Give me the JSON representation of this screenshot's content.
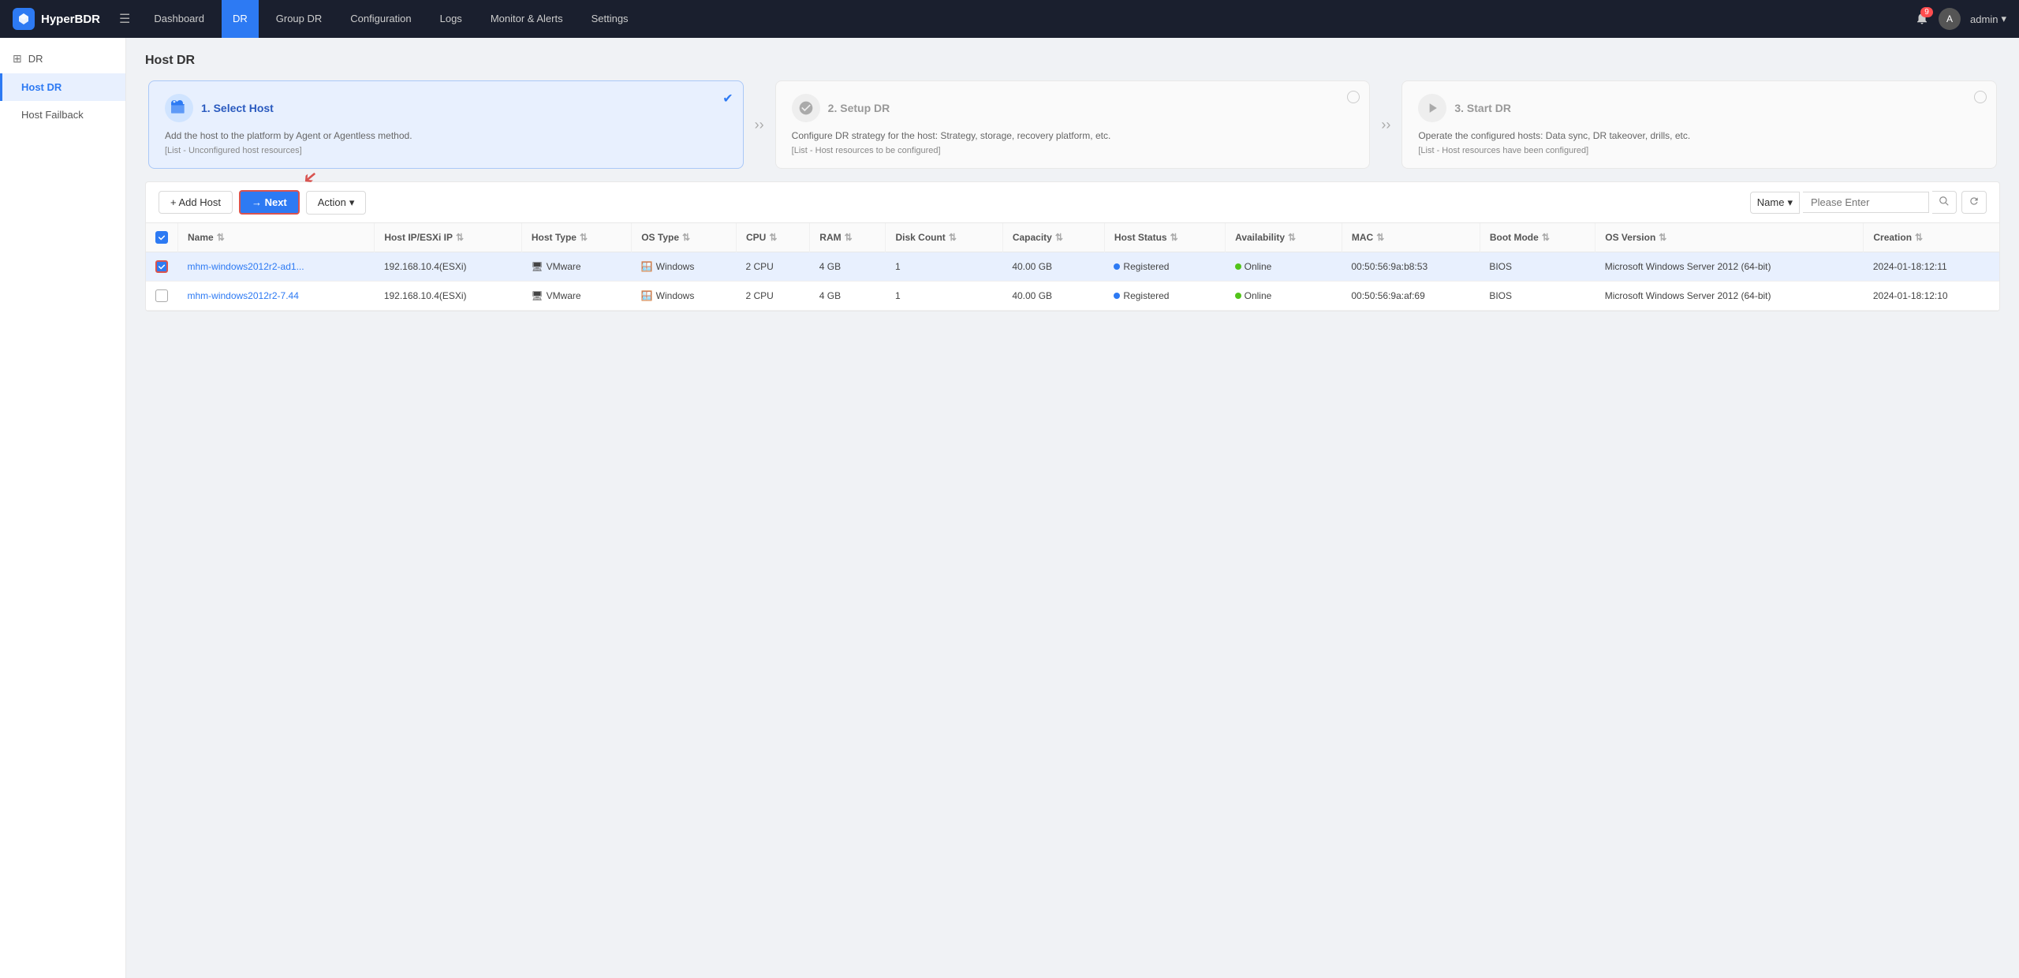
{
  "app": {
    "name": "HyperBDR",
    "logo_text": "HyperBDR"
  },
  "topnav": {
    "items": [
      {
        "label": "Dashboard",
        "active": false
      },
      {
        "label": "DR",
        "active": true
      },
      {
        "label": "Group DR",
        "active": false
      },
      {
        "label": "Configuration",
        "active": false
      },
      {
        "label": "Logs",
        "active": false
      },
      {
        "label": "Monitor & Alerts",
        "active": false
      },
      {
        "label": "Settings",
        "active": false
      }
    ],
    "notification_count": "9",
    "admin_label": "admin"
  },
  "sidebar": {
    "section_label": "DR",
    "items": [
      {
        "label": "Host DR",
        "active": true
      },
      {
        "label": "Host Failback",
        "active": false
      }
    ]
  },
  "breadcrumb": "Host DR",
  "steps": [
    {
      "number": "1.",
      "title": "Select Host",
      "desc": "Add the host to the platform by Agent or Agentless method.",
      "sub": "[List - Unconfigured host resources]",
      "active": true,
      "checked": true
    },
    {
      "number": "2.",
      "title": "Setup DR",
      "desc": "Configure DR strategy for the host: Strategy, storage, recovery platform, etc.",
      "sub": "[List - Host resources to be configured]",
      "active": false,
      "checked": false
    },
    {
      "number": "3.",
      "title": "Start DR",
      "desc": "Operate the configured hosts: Data sync, DR takeover, drills, etc.",
      "sub": "[List - Host resources have been configured]",
      "active": false,
      "checked": false
    }
  ],
  "toolbar": {
    "add_host_label": "+ Add Host",
    "next_label": "→ Next",
    "action_label": "Action",
    "search_field_label": "Name",
    "search_placeholder": "Please Enter"
  },
  "table": {
    "columns": [
      "Name",
      "Host IP/ESXi IP",
      "Host Type",
      "OS Type",
      "CPU",
      "RAM",
      "Disk Count",
      "Capacity",
      "Host Status",
      "Availability",
      "MAC",
      "Boot Mode",
      "OS Version",
      "Creation"
    ],
    "rows": [
      {
        "selected": true,
        "name": "mhm-windows2012r2-ad1...",
        "host_ip": "192.168.10.4(ESXi)",
        "host_type": "VMware",
        "os_type": "Windows",
        "cpu": "2 CPU",
        "ram": "4 GB",
        "disk_count": "1",
        "capacity": "40.00 GB",
        "host_status": "Registered",
        "availability": "Online",
        "mac": "00:50:56:9a:b8:53",
        "boot_mode": "BIOS",
        "os_version": "Microsoft Windows Server 2012 (64-bit)",
        "creation": "2024-01-18:12:11"
      },
      {
        "selected": false,
        "name": "mhm-windows2012r2-7.44",
        "host_ip": "192.168.10.4(ESXi)",
        "host_type": "VMware",
        "os_type": "Windows",
        "cpu": "2 CPU",
        "ram": "4 GB",
        "disk_count": "1",
        "capacity": "40.00 GB",
        "host_status": "Registered",
        "availability": "Online",
        "mac": "00:50:56:9a:af:69",
        "boot_mode": "BIOS",
        "os_version": "Microsoft Windows Server 2012 (64-bit)",
        "creation": "2024-01-18:12:10"
      }
    ]
  }
}
